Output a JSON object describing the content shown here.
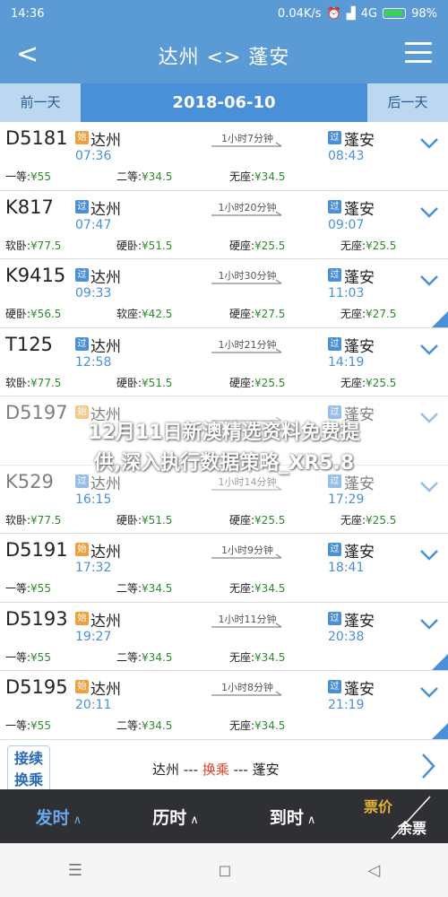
{
  "status_bar": {
    "time": "14:36",
    "network_speed": "0.04K/s",
    "signal_type": "4G",
    "battery": "98%"
  },
  "header": {
    "title": "达州 <> 蓬安"
  },
  "date_bar": {
    "prev": "前一天",
    "date": "2018-06-10",
    "next": "后一天"
  },
  "trains": [
    {
      "no": "D5181",
      "from_tag": "始",
      "from": "达州",
      "dep": "07:36",
      "duration": "1小时7分钟",
      "to_tag": "过",
      "to": "蓬安",
      "arr": "08:43",
      "seats": [
        {
          "label": "一等:",
          "price": "¥55"
        },
        {
          "label": "二等:",
          "price": "¥34.5"
        },
        {
          "label": "无座:",
          "price": "¥34.5"
        }
      ],
      "corner": ""
    },
    {
      "no": "K817",
      "from_tag": "过",
      "from": "达州",
      "dep": "07:47",
      "duration": "1小时20分钟",
      "to_tag": "过",
      "to": "蓬安",
      "arr": "09:07",
      "seats": [
        {
          "label": "软卧:",
          "price": "¥77.5"
        },
        {
          "label": "硬卧:",
          "price": "¥51.5"
        },
        {
          "label": "硬座:",
          "price": "¥25.5"
        },
        {
          "label": "无座:",
          "price": "¥25.5"
        }
      ],
      "corner": ""
    },
    {
      "no": "K9415",
      "from_tag": "过",
      "from": "达州",
      "dep": "09:33",
      "duration": "1小时30分钟",
      "to_tag": "过",
      "to": "蓬安",
      "arr": "11:03",
      "seats": [
        {
          "label": "硬卧:",
          "price": "¥56.5"
        },
        {
          "label": "软座:",
          "price": "¥42.5"
        },
        {
          "label": "硬座:",
          "price": "¥27.5"
        },
        {
          "label": "无座:",
          "price": "¥27.5"
        }
      ],
      "corner": "兑"
    },
    {
      "no": "T125",
      "from_tag": "过",
      "from": "达州",
      "dep": "12:58",
      "duration": "1小时21分钟",
      "to_tag": "过",
      "to": "蓬安",
      "arr": "14:19",
      "seats": [
        {
          "label": "软卧:",
          "price": "¥77.5"
        },
        {
          "label": "硬卧:",
          "price": "¥51.5"
        },
        {
          "label": "硬座:",
          "price": "¥25.5"
        },
        {
          "label": "无座:",
          "price": "¥25.5"
        }
      ],
      "corner": ""
    },
    {
      "no": "D5197",
      "from_tag": "始",
      "from": "达州",
      "dep": "",
      "duration": "",
      "to_tag": "过",
      "to": "蓬安",
      "arr": "",
      "seats": [],
      "corner": ""
    },
    {
      "no": "K529",
      "from_tag": "过",
      "from": "达州",
      "dep": "16:15",
      "duration": "1小时14分钟",
      "to_tag": "过",
      "to": "蓬安",
      "arr": "17:29",
      "seats": [
        {
          "label": "软卧:",
          "price": "¥77.5"
        },
        {
          "label": "硬卧:",
          "price": "¥51.5"
        },
        {
          "label": "硬座:",
          "price": "¥25.5"
        },
        {
          "label": "无座:",
          "price": "¥25.5"
        }
      ],
      "corner": ""
    },
    {
      "no": "D5191",
      "from_tag": "始",
      "from": "达州",
      "dep": "17:32",
      "duration": "1小时9分钟",
      "to_tag": "过",
      "to": "蓬安",
      "arr": "18:41",
      "seats": [
        {
          "label": "一等:",
          "price": "¥55"
        },
        {
          "label": "二等:",
          "price": "¥34.5"
        },
        {
          "label": "无座:",
          "price": "¥34.5"
        }
      ],
      "corner": ""
    },
    {
      "no": "D5193",
      "from_tag": "始",
      "from": "达州",
      "dep": "19:27",
      "duration": "1小时11分钟",
      "to_tag": "过",
      "to": "蓬安",
      "arr": "20:38",
      "seats": [
        {
          "label": "一等:",
          "price": "¥55"
        },
        {
          "label": "二等:",
          "price": "¥34.5"
        },
        {
          "label": "无座:",
          "price": "¥34.5"
        }
      ],
      "corner": "兑"
    },
    {
      "no": "D5195",
      "from_tag": "始",
      "from": "达州",
      "dep": "20:11",
      "duration": "1小时8分钟",
      "to_tag": "过",
      "to": "蓬安",
      "arr": "21:19",
      "seats": [
        {
          "label": "一等:",
          "price": "¥55"
        },
        {
          "label": "二等:",
          "price": "¥34.5"
        },
        {
          "label": "无座:",
          "price": "¥34.5"
        }
      ],
      "corner": "兑"
    }
  ],
  "transfer": {
    "box_line1": "接续",
    "box_line2": "换乘",
    "from": "达州 --- ",
    "mid": "换乘",
    "to": " --- 蓬安"
  },
  "tabbar": {
    "depart": "发时",
    "duration": "历时",
    "arrive": "到时",
    "price": "票价",
    "remain": "余票",
    "caret": "∧"
  },
  "overlay": {
    "line1": "12月11日新澳精选资料免费提",
    "line2": "供,深入执行数据策略_XR5.8"
  },
  "navbar": {
    "menu": "☰",
    "home": "◻",
    "back": "◁"
  }
}
